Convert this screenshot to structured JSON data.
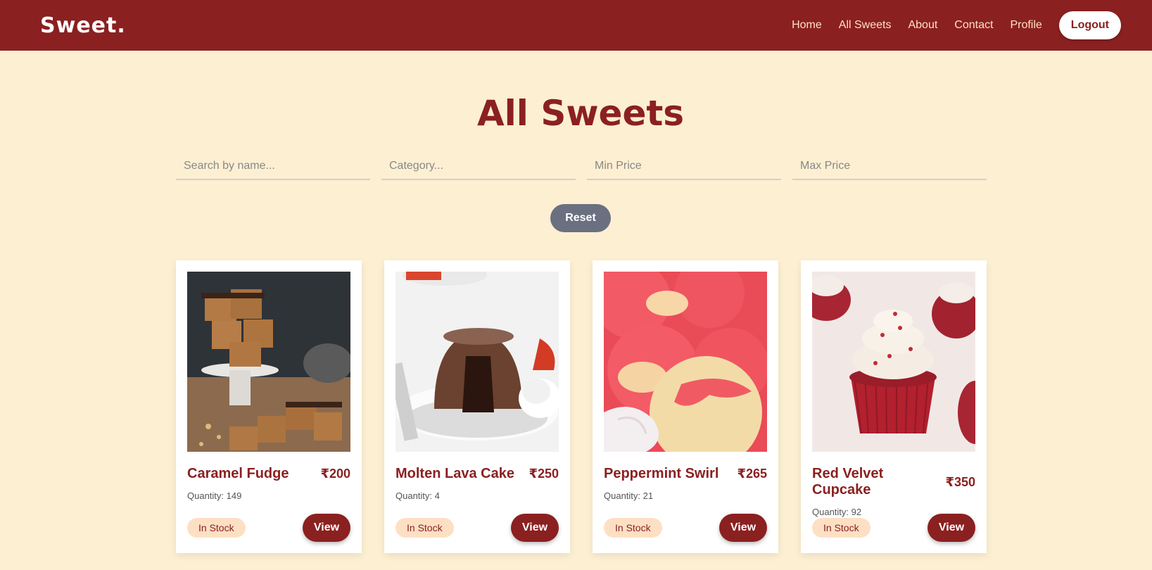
{
  "nav": {
    "logo": "Sweet.",
    "links": [
      "Home",
      "All Sweets",
      "About",
      "Contact",
      "Profile"
    ],
    "logout_label": "Logout"
  },
  "page": {
    "title": "All Sweets"
  },
  "filters": {
    "search_placeholder": "Search by name...",
    "category_placeholder": "Category...",
    "min_price_placeholder": "Min Price",
    "max_price_placeholder": "Max Price",
    "reset_label": "Reset"
  },
  "products": [
    {
      "name": "Caramel Fudge",
      "price": "₹200",
      "quantity": "Quantity: 149",
      "stock": "In Stock",
      "view_label": "View"
    },
    {
      "name": "Molten Lava Cake",
      "price": "₹250",
      "quantity": "Quantity: 4",
      "stock": "In Stock",
      "view_label": "View"
    },
    {
      "name": "Peppermint Swirl",
      "price": "₹265",
      "quantity": "Quantity: 21",
      "stock": "In Stock",
      "view_label": "View"
    },
    {
      "name": "Red Velvet Cupcake",
      "price": "₹350",
      "quantity": "Quantity: 92",
      "stock": "In Stock",
      "view_label": "View"
    }
  ],
  "colors": {
    "brand": "#8b2020",
    "background": "#fdefd2",
    "badge": "#fde0c4",
    "reset": "#6b7080"
  }
}
